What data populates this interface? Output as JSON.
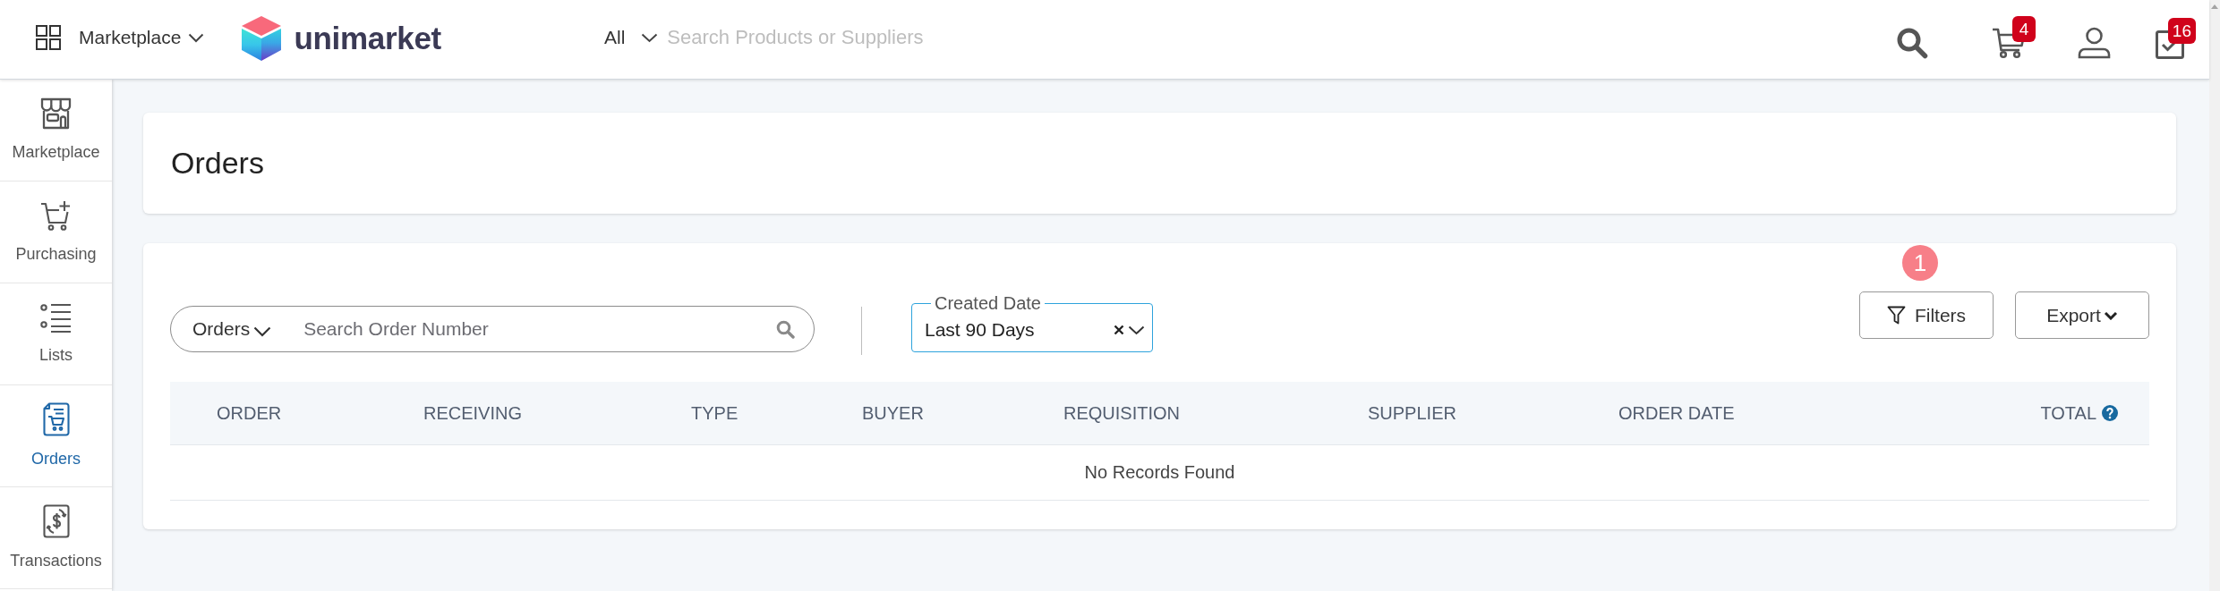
{
  "header": {
    "app_menu": {
      "label": "Marketplace"
    },
    "logo": {
      "text": "unimarket"
    },
    "search": {
      "scope": "All",
      "placeholder": "Search Products or Suppliers"
    },
    "cart": {
      "badge": "4"
    },
    "tasks": {
      "badge": "16"
    }
  },
  "sidebar": {
    "items": [
      {
        "label": "Marketplace",
        "selected": false
      },
      {
        "label": "Purchasing",
        "selected": false
      },
      {
        "label": "Lists",
        "selected": false
      },
      {
        "label": "Orders",
        "selected": true
      },
      {
        "label": "Transactions",
        "selected": false
      }
    ]
  },
  "page": {
    "title": "Orders"
  },
  "toolbar": {
    "search_type": "Orders",
    "search_placeholder": "Search Order Number",
    "date_filter": {
      "label": "Created Date",
      "value": "Last 90 Days"
    },
    "filters": {
      "label": "Filters",
      "count": "1"
    },
    "export": {
      "label": "Export"
    }
  },
  "table": {
    "columns": [
      {
        "label": "ORDER",
        "help": false
      },
      {
        "label": "RECEIVING",
        "help": false
      },
      {
        "label": "TYPE",
        "help": false
      },
      {
        "label": "BUYER",
        "help": false
      },
      {
        "label": "REQUISITION",
        "help": false
      },
      {
        "label": "SUPPLIER",
        "help": false
      },
      {
        "label": "ORDER DATE",
        "help": false
      },
      {
        "label": "TOTAL",
        "help": true
      }
    ],
    "empty_message": "No Records Found"
  }
}
